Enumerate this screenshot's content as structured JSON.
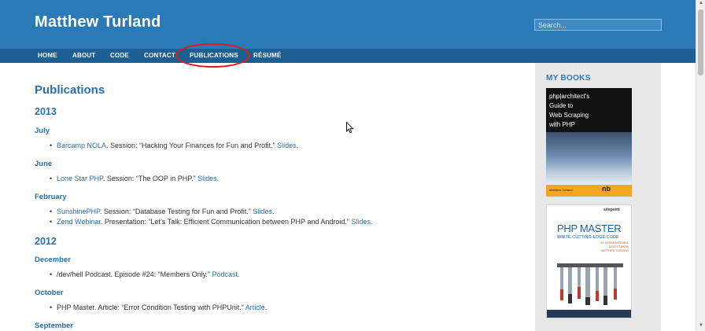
{
  "site": {
    "title": "Matthew Turland"
  },
  "search": {
    "placeholder": "Search..."
  },
  "nav": {
    "items": [
      "HOME",
      "ABOUT",
      "CODE",
      "CONTACT",
      "PUBLICATIONS",
      "RÉSUMÉ"
    ],
    "highlighted": "PUBLICATIONS",
    "highlight_color": "#dd1c1c"
  },
  "main": {
    "title": "Publications",
    "years": [
      {
        "year": "2013",
        "months": [
          {
            "month": "July",
            "entries": [
              {
                "link": "Barcamp NOLA",
                "text": ". Session: “Hacking Your Finances for Fun and Profit.” ",
                "link2": "Slides",
                "end": "."
              }
            ]
          },
          {
            "month": "June",
            "entries": [
              {
                "link": "Lone Star PHP",
                "text": ". Session: “The OOP in PHP.” ",
                "link2": "Slides",
                "end": "."
              }
            ]
          },
          {
            "month": "February",
            "entries": [
              {
                "link": "SunshinePHP",
                "text": ". Session: “Database Testing for Fun and Profit.” ",
                "link2": "Slides",
                "end": "."
              },
              {
                "link": "Zend Webinar",
                "text": ". Presentation: “Let’s Talk: Efficient Communication between PHP and Android.” ",
                "link2": "Slides",
                "end": "."
              }
            ]
          }
        ]
      },
      {
        "year": "2012",
        "months": [
          {
            "month": "December",
            "entries": [
              {
                "text": "/dev/hell Podcast. Episode #24: “Members Only.” ",
                "link2": "Podcast",
                "end": "."
              }
            ]
          },
          {
            "month": "October",
            "entries": [
              {
                "text": "PHP Master. Article: “Error Condition Testing with PHPUnit.” ",
                "link2": "Article",
                "end": "."
              }
            ]
          },
          {
            "month": "September",
            "entries": []
          }
        ]
      }
    ]
  },
  "sidebar": {
    "title": "MY BOOKS",
    "book1": {
      "cover_lines": [
        "php|architect's",
        "Guide to",
        "Web Scraping",
        "with PHP"
      ],
      "author": "Matthew Turland",
      "publisher_mark": "nb"
    },
    "book2": {
      "brand": "sitepoint",
      "title": "PHP MASTER",
      "subtitle": "WRITE CUTTING-EDGE CODE",
      "authors": [
        "BY LORNA MITCHELL",
        "DAVEY SHAFIK",
        "MATTHEW TURLAND"
      ]
    }
  },
  "colors": {
    "header": "#2a7ab8",
    "nav": "#1c5f93",
    "heading": "#2770ab",
    "link": "#2a6fa8",
    "sidebar_bg": "#e8e8e8"
  }
}
